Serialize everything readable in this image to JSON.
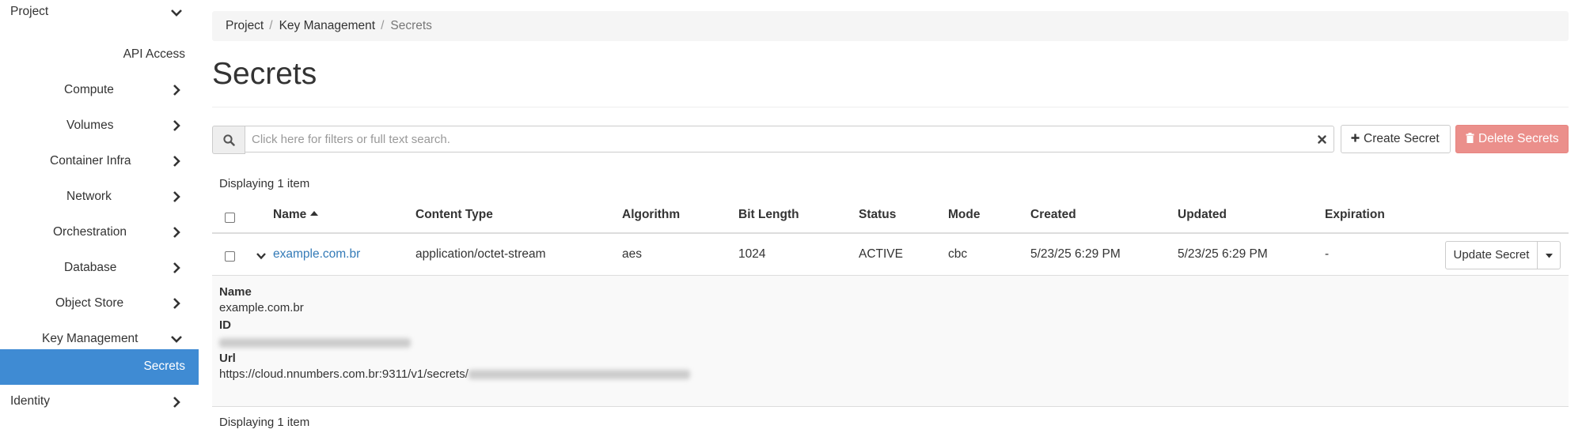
{
  "sidebar": {
    "project_label": "Project",
    "items": [
      {
        "label": "API Access"
      },
      {
        "label": "Compute"
      },
      {
        "label": "Volumes"
      },
      {
        "label": "Container Infra"
      },
      {
        "label": "Network"
      },
      {
        "label": "Orchestration"
      },
      {
        "label": "Database"
      },
      {
        "label": "Object Store"
      },
      {
        "label": "Key Management"
      },
      {
        "label": "Secrets"
      }
    ],
    "identity_label": "Identity"
  },
  "breadcrumb": {
    "items": [
      "Project",
      "Key Management",
      "Secrets"
    ],
    "separator": "/"
  },
  "page": {
    "title": "Secrets"
  },
  "search": {
    "placeholder": "Click here for filters or full text search."
  },
  "actions": {
    "create_label": "Create Secret",
    "delete_label": "Delete Secrets"
  },
  "table": {
    "display_count": "Displaying 1 item",
    "columns": [
      "Name",
      "Content Type",
      "Algorithm",
      "Bit Length",
      "Status",
      "Mode",
      "Created",
      "Updated",
      "Expiration"
    ],
    "rows": [
      {
        "name": "example.com.br",
        "content_type": "application/octet-stream",
        "algorithm": "aes",
        "bit_length": "1024",
        "status": "ACTIVE",
        "mode": "cbc",
        "created": "5/23/25 6:29 PM",
        "updated": "5/23/25 6:29 PM",
        "expiration": "-",
        "action_label": "Update Secret"
      }
    ],
    "detail": {
      "name_term": "Name",
      "name_value": "example.com.br",
      "id_term": "ID",
      "url_term": "Url",
      "url_prefix": "https://cloud.nnumbers.com.br:9311/v1/secrets/"
    }
  },
  "colors": {
    "active_nav": "#3f8bd3",
    "link": "#337ab7",
    "danger_button": "#eb8f8b"
  }
}
